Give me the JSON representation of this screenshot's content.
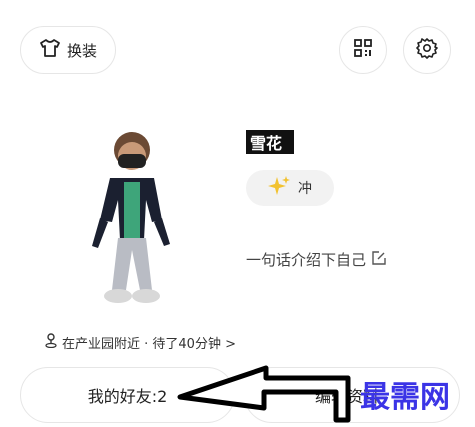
{
  "header": {
    "outfit_label": "换装",
    "outfit_icon": "tshirt-icon",
    "qr_icon": "qr-code-icon",
    "settings_icon": "gear-icon"
  },
  "profile": {
    "username": "雪花",
    "status_label": "冲",
    "status_icon": "sparkle-icon",
    "bio_placeholder": "一句话介绍下自己",
    "bio_edit_icon": "edit-icon",
    "location_text": "在产业园附近 · 待了40分钟 >",
    "location_icon": "person-pin-icon"
  },
  "actions": {
    "friends_label": "我的好友:2",
    "edit_label": "编辑资料"
  },
  "watermark": "最需网",
  "colors": {
    "sparkle": "#f2c230",
    "watermark": "#3b34e6"
  }
}
